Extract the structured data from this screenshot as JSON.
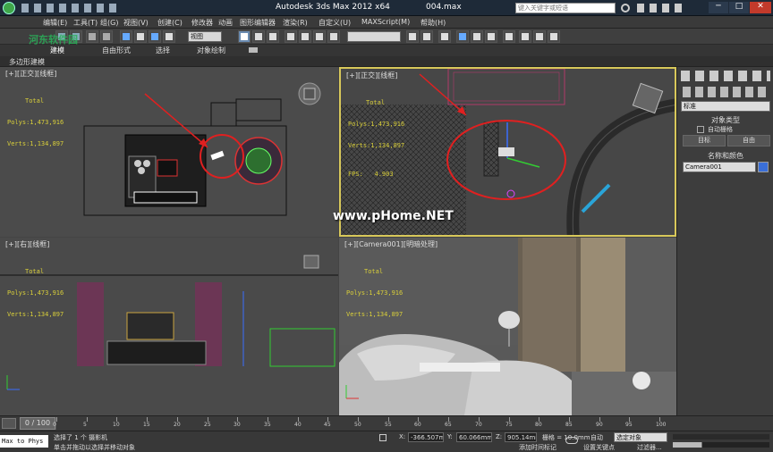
{
  "titlebar": {
    "app_title": "Autodesk 3ds Max  2012 x64",
    "file_name": "004.max",
    "search_placeholder": "键入关键字或短语"
  },
  "menubar": {
    "items": [
      "编辑(E)",
      "工具(T)",
      "组(G)",
      "视图(V)",
      "创建(C)",
      "修改器",
      "动画",
      "图形编辑器",
      "渲染(R)",
      "自定义(U)",
      "MAXScript(M)",
      "帮助(H)"
    ],
    "watermark": "河东软件园"
  },
  "toolbar": {
    "view_select": "视图",
    "selection_set": ""
  },
  "ribbon": {
    "tabs": [
      "建模",
      "自由形式",
      "选择",
      "对象绘制"
    ],
    "sub_label": "多边形建模"
  },
  "viewports": {
    "top_left": {
      "label": "[+][正交][线框]",
      "total": "Total",
      "polys": "Polys:1,473,916",
      "verts": "Verts:1,134,897"
    },
    "top_right": {
      "label": "[+][正交][线框]",
      "total": "Total",
      "polys": "Polys:1,473,916",
      "verts": "Verts:1,134,897",
      "fps": "FPS:   4.903"
    },
    "bottom_left": {
      "label": "[+][右][线框]",
      "total": "Total",
      "polys": "Polys:1,473,916",
      "verts": "Verts:1,134,897"
    },
    "bottom_right": {
      "label": "[+][Camera001][明暗处理]",
      "total": "Total",
      "polys": "Polys:1,473,916",
      "verts": "Verts:1,134,897"
    },
    "watermark": "www.pHome.NET"
  },
  "command_panel": {
    "dropdown": "标准",
    "rollout_object_type": "对象类型",
    "auto_grid": "自动栅格",
    "btn_target": "目标",
    "btn_free": "自由",
    "rollout_name_color": "名称和颜色",
    "object_name": "Camera001",
    "object_color": "#3a6fd8"
  },
  "timeline": {
    "frame": "0 / 100",
    "ticks": [
      "0",
      "5",
      "10",
      "15",
      "20",
      "25",
      "30",
      "35",
      "40",
      "45",
      "50",
      "55",
      "60",
      "65",
      "70",
      "75",
      "80",
      "85",
      "90",
      "95",
      "100"
    ]
  },
  "status": {
    "maxscript": "Max to Phys",
    "line1": "选择了 1 个 摄影机",
    "line2": "单击并拖动以选择并移动对象",
    "x_label": "X:",
    "x_value": "-366.507m",
    "y_label": "Y:",
    "y_value": "60.066mm",
    "z_label": "Z:",
    "z_value": "905.14mm",
    "grid": "栅格 = 10.0mm",
    "add_time_tag": "添加时间标记",
    "auto_key": "自动",
    "set_key": "设置关键点",
    "selected_dropdown": "选定对象",
    "filters": "过滤器..."
  },
  "colors": {
    "accent": "#d02020",
    "stats_yellow": "#d9cf3a"
  }
}
